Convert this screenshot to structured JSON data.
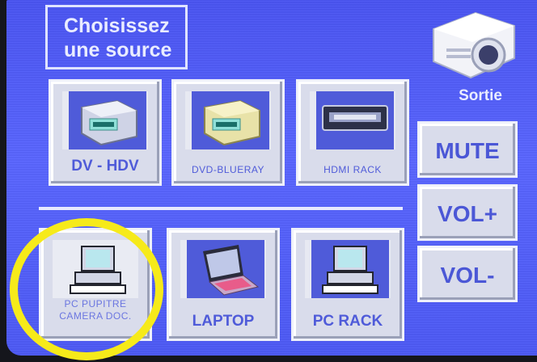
{
  "title": {
    "line1": "Choisissez",
    "line2": "une source"
  },
  "sources": [
    {
      "label": "DV - HDV",
      "icon": "tape-deck-icon"
    },
    {
      "label": "DVD-BLUERAY",
      "icon": "tape-deck-icon"
    },
    {
      "label": "HDMI RACK",
      "icon": "rack-device-icon"
    },
    {
      "label_line1": "PC PUPITRE",
      "label_line2": "CAMERA DOC.",
      "icon": "computer-icon"
    },
    {
      "label": "LAPTOP",
      "icon": "laptop-icon"
    },
    {
      "label": "PC RACK",
      "icon": "computer-icon"
    }
  ],
  "output": {
    "label": "Sortie",
    "icon": "projector-icon"
  },
  "controls": {
    "mute": "MUTE",
    "vol_up": "VOL+",
    "vol_down": "VOL-"
  },
  "colors": {
    "screen": "#5a66ff",
    "button": "#d9dceb",
    "label": "#4f5bd9",
    "highlight": "#f6ea1a"
  }
}
